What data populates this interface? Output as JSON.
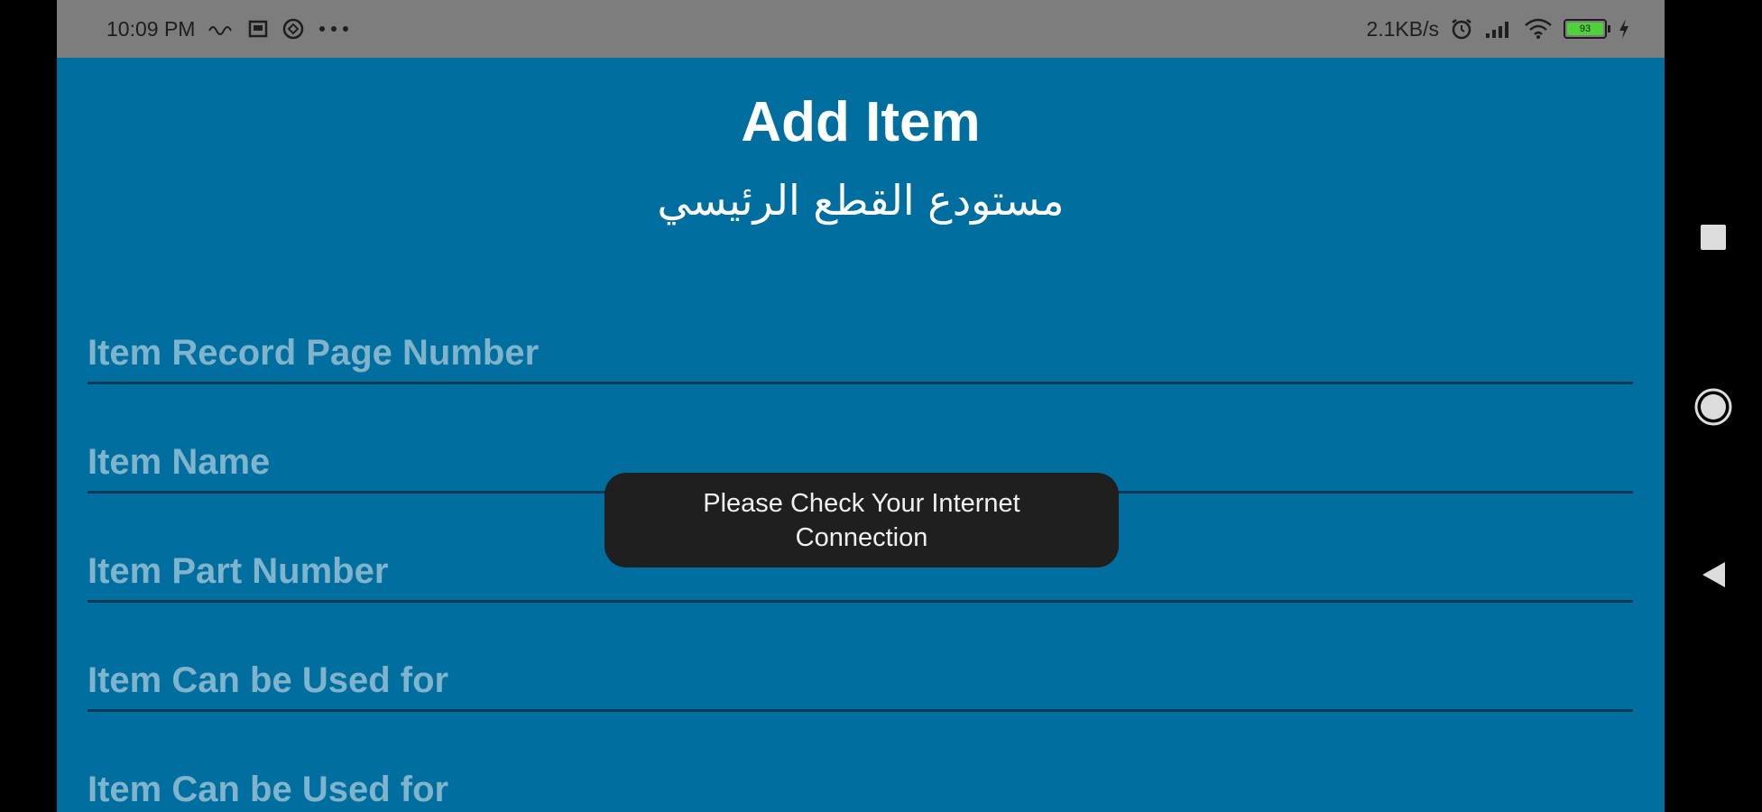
{
  "status_bar": {
    "time": "10:09 PM",
    "left_icons": [
      "signal-wave-icon",
      "notification-icon",
      "sync-icon",
      "more-dots-icon"
    ],
    "network_speed": "2.1KB/s",
    "right_icons": [
      "alarm-icon",
      "cell-signal-icon",
      "wifi-icon",
      "battery-icon",
      "charging-icon"
    ],
    "battery_level": "93"
  },
  "header": {
    "title": "Add Item",
    "subtitle": "مستودع القطع الرئيسي"
  },
  "form": {
    "fields": [
      {
        "placeholder": "Item Record Page Number",
        "value": ""
      },
      {
        "placeholder": "Item Name",
        "value": ""
      },
      {
        "placeholder": "Item Part Number",
        "value": ""
      },
      {
        "placeholder": "Item Can be Used for",
        "value": ""
      },
      {
        "placeholder": "Item Can be Used for",
        "value": ""
      }
    ]
  },
  "toast": {
    "message": "Please Check Your Internet Connection"
  },
  "nav": {
    "buttons": [
      "recents-square-icon",
      "home-circle-icon",
      "back-triangle-icon"
    ]
  },
  "colors": {
    "background": "#006e9e",
    "status_bar": "#7d7d7d",
    "toast": "#1f1f1f",
    "battery": "#4ed23a"
  }
}
